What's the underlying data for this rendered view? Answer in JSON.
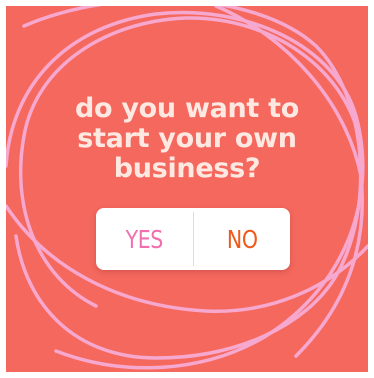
{
  "story": {
    "background_color": "#f5685e",
    "scribble_color": "#f7a8cf",
    "question": "do you want to start your own business?",
    "poll": {
      "yes_label": "YES",
      "no_label": "NO",
      "yes_color": "#f06fae",
      "no_color": "#ef5a1b"
    }
  }
}
